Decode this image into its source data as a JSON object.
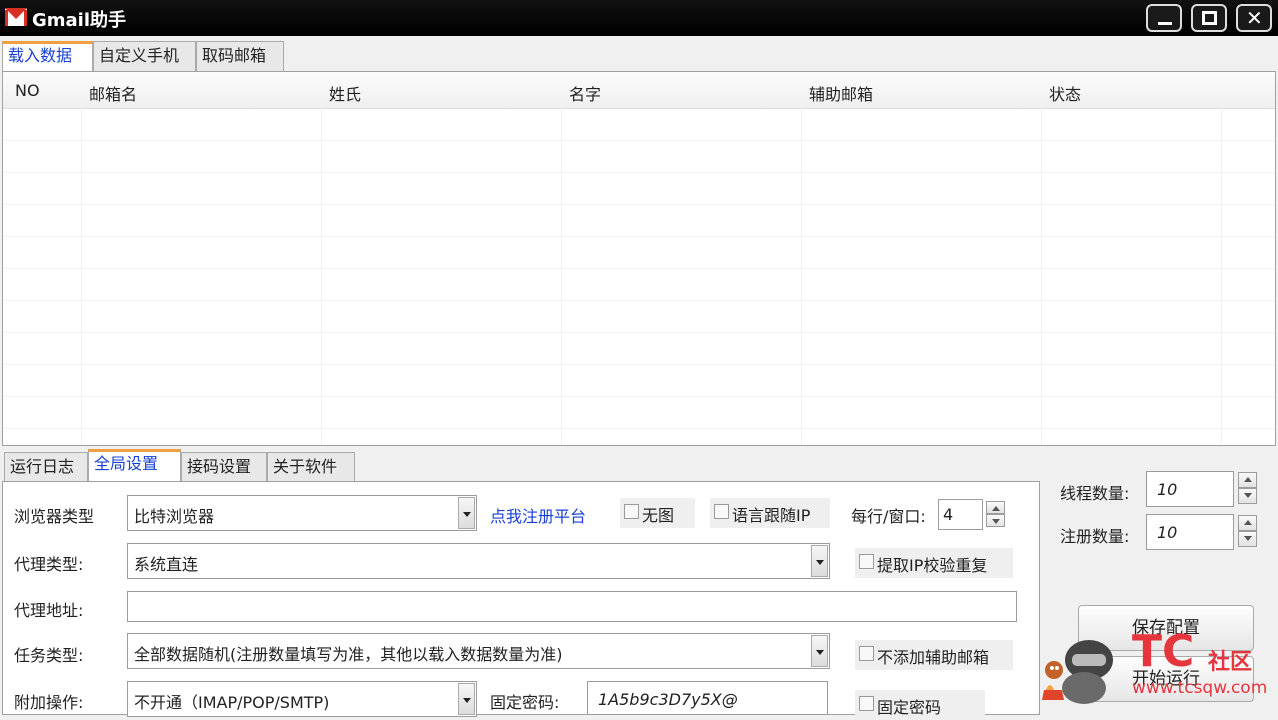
{
  "window": {
    "title": "Gmail助手",
    "minimize_icon": "minimize-icon",
    "maximize_icon": "maximize-icon",
    "close_icon": "close-icon",
    "close_glyph": "✕"
  },
  "top_tabs": [
    "载入数据",
    "自定义手机",
    "取码邮箱"
  ],
  "table": {
    "columns": [
      "NO",
      "邮箱名",
      "姓氏",
      "名字",
      "辅助邮箱",
      "状态"
    ],
    "rows": []
  },
  "bottom_tabs": [
    "运行日志",
    "全局设置",
    "接码设置",
    "关于软件"
  ],
  "settings": {
    "browser_type_label": "浏览器类型",
    "browser_type_value": "比特浏览器",
    "register_platform_link": "点我注册平台",
    "no_image_label": "无图",
    "language_follow_ip_label": "语言跟随IP",
    "per_row_window_label": "每行/窗口:",
    "per_row_window_value": "4",
    "proxy_type_label": "代理类型:",
    "proxy_type_value": "系统直连",
    "extract_ip_check_label": "提取IP校验重复",
    "proxy_address_label": "代理地址:",
    "proxy_address_value": "",
    "task_type_label": "任务类型:",
    "task_type_value": "全部数据随机(注册数量填写为准，其他以载入数据数量为准)",
    "no_aux_email_label": "不添加辅助邮箱",
    "extra_op_label": "附加操作:",
    "extra_op_value": "不开通（IMAP/POP/SMTP)",
    "fixed_password_label": "固定密码:",
    "fixed_password_value": "1A5b9c3D7y5X@",
    "fixed_password_check_label": "固定密码"
  },
  "side": {
    "thread_count_label": "线程数量:",
    "thread_count_value": "10",
    "register_count_label": "注册数量:",
    "register_count_value": "10",
    "save_config_button": "保存配置",
    "start_run_button": "开始运行"
  },
  "watermark": {
    "brand": "TC",
    "brand_cn": "社区",
    "url": "www.tcsqw.com"
  },
  "colors": {
    "title_bar": "#000000",
    "active_tab_text": "#1a3fd6",
    "active_tab_accent": "#f0a040",
    "watermark": "#e5363d"
  }
}
